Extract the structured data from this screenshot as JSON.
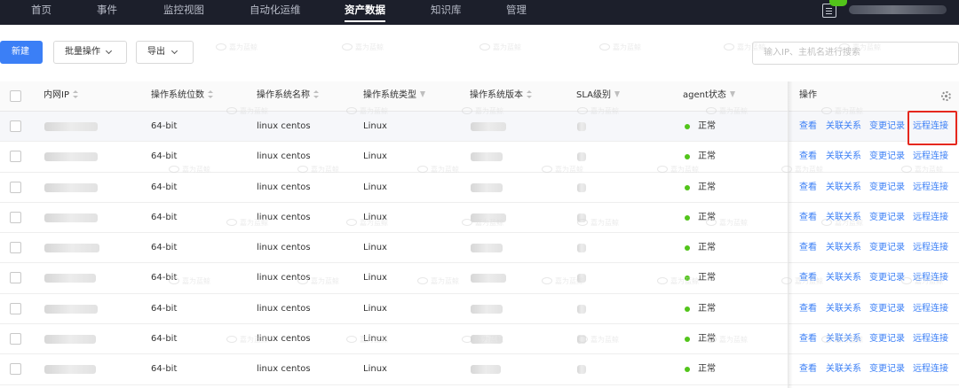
{
  "nav": {
    "items": [
      "首页",
      "事件",
      "监控视图",
      "自动化运维",
      "资产数据",
      "知识库",
      "管理"
    ],
    "active_index": 4
  },
  "toolbar": {
    "new_label": "新建",
    "batch_label": "批量操作",
    "export_label": "导出",
    "search_placeholder": "输入IP、主机名进行搜索"
  },
  "table": {
    "headers": {
      "ip": "内网IP",
      "bits": "操作系统位数",
      "os_name": "操作系统名称",
      "os_type": "操作系统类型",
      "os_version": "操作系统版本",
      "sla": "SLA级别",
      "agent": "agent状态",
      "ops": "操作"
    },
    "rows": [
      {
        "bits": "64-bit",
        "os_name": "linux centos",
        "os_type": "Linux",
        "agent": "正常"
      },
      {
        "bits": "64-bit",
        "os_name": "linux centos",
        "os_type": "Linux",
        "agent": "正常"
      },
      {
        "bits": "64-bit",
        "os_name": "linux centos",
        "os_type": "Linux",
        "agent": "正常"
      },
      {
        "bits": "64-bit",
        "os_name": "linux centos",
        "os_type": "Linux",
        "agent": "正常"
      },
      {
        "bits": "64-bit",
        "os_name": "linux centos",
        "os_type": "Linux",
        "agent": "正常"
      },
      {
        "bits": "64-bit",
        "os_name": "linux centos",
        "os_type": "Linux",
        "agent": "正常"
      },
      {
        "bits": "64-bit",
        "os_name": "linux centos",
        "os_type": "Linux",
        "agent": "正常"
      },
      {
        "bits": "64-bit",
        "os_name": "linux centos",
        "os_type": "Linux",
        "agent": "正常"
      },
      {
        "bits": "64-bit",
        "os_name": "linux centos",
        "os_type": "Linux",
        "agent": "正常"
      }
    ],
    "actions": [
      "查看",
      "关联关系",
      "变更记录",
      "远程连接"
    ]
  },
  "watermark_text": "嘉为蓝鲸",
  "colors": {
    "accent": "#3b7ff6",
    "nav_bg": "#1c1f2b",
    "status_ok": "#52c41a",
    "highlight_box": "#e5271d"
  }
}
